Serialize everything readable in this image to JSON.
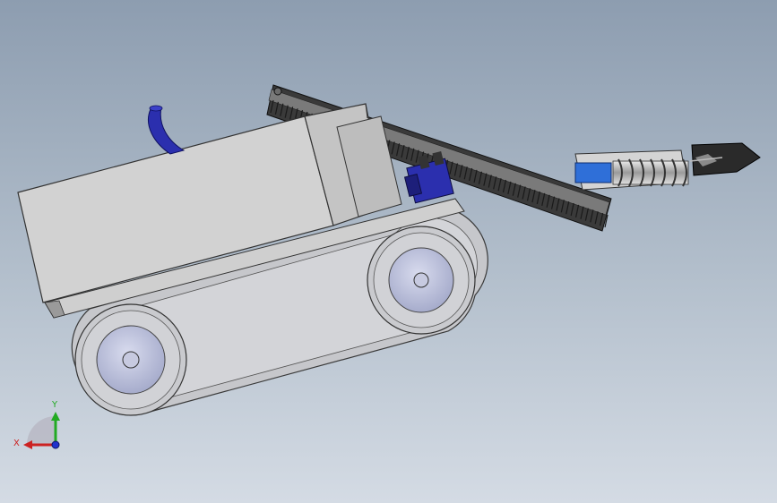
{
  "scene": {
    "colors": {
      "background_top": "#8d9db0",
      "background_bottom": "#d4dbe4",
      "body_fill": "#d0d0d0",
      "body_edge": "#3a3a3a",
      "track_fill": "#c8c8cc",
      "wheel_hub": "#b8bcd6",
      "conveyor_dark": "#2b2b2b",
      "motor_blue": "#2b2fae",
      "accent_blue": "#2f6fd8",
      "axis_x": "#cc2222",
      "axis_y": "#22aa22",
      "axis_z": "#2233cc"
    },
    "triad": {
      "x_label": "X",
      "y_label": "Y"
    }
  }
}
